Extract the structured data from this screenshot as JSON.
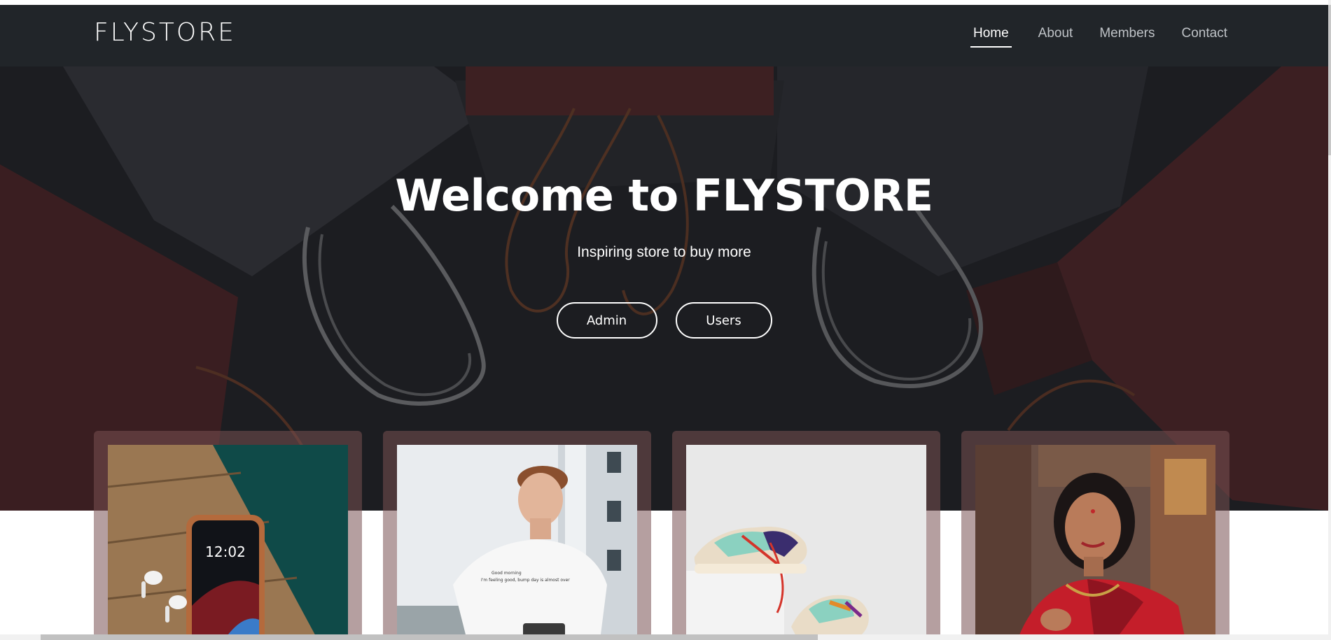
{
  "navbar": {
    "brand": "FLYSTORE",
    "links": [
      {
        "label": "Home",
        "active": true
      },
      {
        "label": "About",
        "active": false
      },
      {
        "label": "Members",
        "active": false
      },
      {
        "label": "Contact",
        "active": false
      }
    ]
  },
  "hero": {
    "title": "Welcome to FLYSTORE",
    "subtitle": "Inspiring store to buy more",
    "buttons": {
      "admin": "Admin",
      "users": "Users"
    }
  },
  "products": {
    "items": [
      {
        "image": "phone-with-earbuds-photo"
      },
      {
        "image": "man-in-white-tshirt-photo"
      },
      {
        "image": "sneakers-photo"
      },
      {
        "image": "woman-in-red-saree-photo"
      }
    ]
  },
  "colors": {
    "navbar_bg": "#212529",
    "hero_bg": "#1b1c20",
    "card_frame": "#785052",
    "accent_red": "#c0282b"
  }
}
